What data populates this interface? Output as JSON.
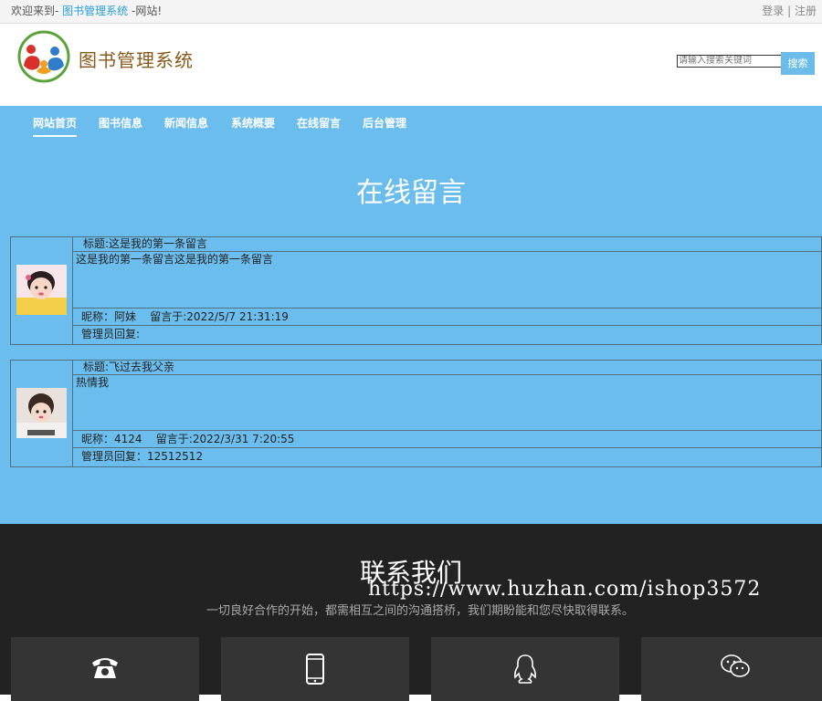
{
  "topbar": {
    "welcome_prefix": "欢迎来到- ",
    "site_name": "图书管理系统",
    "welcome_suffix": " -网站!",
    "login": "登录",
    "separator": " | ",
    "register": "注册"
  },
  "header": {
    "logo_text": "图书管理系统",
    "search_placeholder": "请输入搜索关键词",
    "search_button": "搜索"
  },
  "nav": [
    {
      "label": "网站首页",
      "active": true
    },
    {
      "label": "图书信息",
      "active": false
    },
    {
      "label": "新闻信息",
      "active": false
    },
    {
      "label": "系统概要",
      "active": false
    },
    {
      "label": "在线留言",
      "active": false
    },
    {
      "label": "后台管理",
      "active": false
    }
  ],
  "page_title": "在线留言",
  "messages": [
    {
      "title": "标题:这是我的第一条留言",
      "content": "这是我的第一条留言这是我的第一条留言",
      "meta": "昵称：阿妹    留言于:2022/5/7 21:31:19",
      "reply": "管理员回复:"
    },
    {
      "title": "标题:飞过去我父亲",
      "content": "热情我",
      "meta": "昵称：4124    留言于:2022/3/31 7:20:55",
      "reply": "管理员回复：12512512"
    }
  ],
  "footer": {
    "title": "联系我们",
    "subtitle": "一切良好合作的开始，都需相互之间的沟通搭桥，我们期盼能和您尽快取得联系。",
    "watermark": "https://www.huzhan.com/ishop3572",
    "cards": [
      "phone-icon",
      "mobile-icon",
      "qq-icon",
      "wechat-icon"
    ]
  },
  "colors": {
    "accent": "#6bbdee",
    "footer_bg": "#222222",
    "site_name": "#2a9fd6"
  }
}
